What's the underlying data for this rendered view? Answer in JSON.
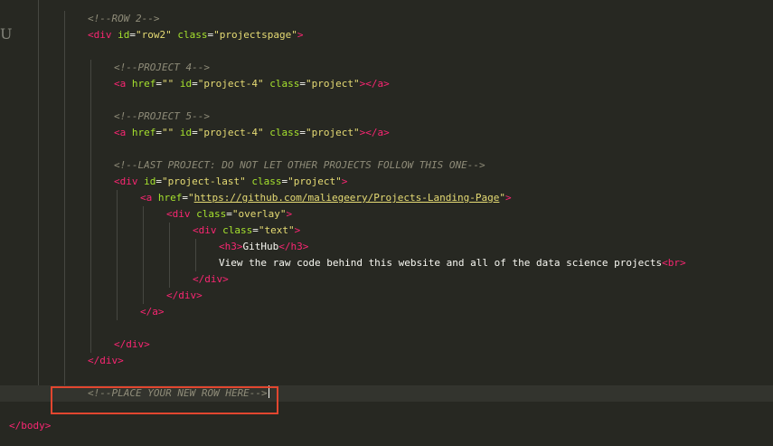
{
  "stray_glyph": "U",
  "lines": [
    {
      "indent": 3,
      "tokens": [
        {
          "t": "comment",
          "v": "<!--ROW 2-->"
        }
      ]
    },
    {
      "indent": 3,
      "tokens": [
        {
          "t": "tag",
          "v": "<div"
        },
        {
          "t": "punct",
          "v": " "
        },
        {
          "t": "attr",
          "v": "id"
        },
        {
          "t": "punct",
          "v": "="
        },
        {
          "t": "string",
          "v": "\"row2\""
        },
        {
          "t": "punct",
          "v": " "
        },
        {
          "t": "attr",
          "v": "class"
        },
        {
          "t": "punct",
          "v": "="
        },
        {
          "t": "string",
          "v": "\"projectspage\""
        },
        {
          "t": "tag",
          "v": ">"
        }
      ]
    },
    {
      "indent": 0,
      "tokens": []
    },
    {
      "indent": 4,
      "tokens": [
        {
          "t": "comment",
          "v": "<!--PROJECT 4-->"
        }
      ]
    },
    {
      "indent": 4,
      "tokens": [
        {
          "t": "tag",
          "v": "<a"
        },
        {
          "t": "punct",
          "v": " "
        },
        {
          "t": "attr",
          "v": "href"
        },
        {
          "t": "punct",
          "v": "="
        },
        {
          "t": "string",
          "v": "\"\""
        },
        {
          "t": "punct",
          "v": " "
        },
        {
          "t": "attr",
          "v": "id"
        },
        {
          "t": "punct",
          "v": "="
        },
        {
          "t": "string",
          "v": "\"project-4\""
        },
        {
          "t": "punct",
          "v": " "
        },
        {
          "t": "attr",
          "v": "class"
        },
        {
          "t": "punct",
          "v": "="
        },
        {
          "t": "string",
          "v": "\"project\""
        },
        {
          "t": "tag",
          "v": "></a>"
        }
      ]
    },
    {
      "indent": 0,
      "tokens": []
    },
    {
      "indent": 4,
      "tokens": [
        {
          "t": "comment",
          "v": "<!--PROJECT 5-->"
        }
      ]
    },
    {
      "indent": 4,
      "tokens": [
        {
          "t": "tag",
          "v": "<a"
        },
        {
          "t": "punct",
          "v": " "
        },
        {
          "t": "attr",
          "v": "href"
        },
        {
          "t": "punct",
          "v": "="
        },
        {
          "t": "string",
          "v": "\"\""
        },
        {
          "t": "punct",
          "v": " "
        },
        {
          "t": "attr",
          "v": "id"
        },
        {
          "t": "punct",
          "v": "="
        },
        {
          "t": "string",
          "v": "\"project-4\""
        },
        {
          "t": "punct",
          "v": " "
        },
        {
          "t": "attr",
          "v": "class"
        },
        {
          "t": "punct",
          "v": "="
        },
        {
          "t": "string",
          "v": "\"project\""
        },
        {
          "t": "tag",
          "v": "></a>"
        }
      ]
    },
    {
      "indent": 0,
      "tokens": []
    },
    {
      "indent": 4,
      "tokens": [
        {
          "t": "comment",
          "v": "<!--LAST PROJECT: DO NOT LET OTHER PROJECTS FOLLOW THIS ONE-->"
        }
      ]
    },
    {
      "indent": 4,
      "tokens": [
        {
          "t": "tag",
          "v": "<div"
        },
        {
          "t": "punct",
          "v": " "
        },
        {
          "t": "attr",
          "v": "id"
        },
        {
          "t": "punct",
          "v": "="
        },
        {
          "t": "string",
          "v": "\"project-last\""
        },
        {
          "t": "punct",
          "v": " "
        },
        {
          "t": "attr",
          "v": "class"
        },
        {
          "t": "punct",
          "v": "="
        },
        {
          "t": "string",
          "v": "\"project\""
        },
        {
          "t": "tag",
          "v": ">"
        }
      ]
    },
    {
      "indent": 5,
      "tokens": [
        {
          "t": "tag",
          "v": "<a"
        },
        {
          "t": "punct",
          "v": " "
        },
        {
          "t": "attr",
          "v": "href"
        },
        {
          "t": "punct",
          "v": "="
        },
        {
          "t": "string",
          "v": "\""
        },
        {
          "t": "link",
          "v": "https://github.com/maliegeery/Projects-Landing-Page"
        },
        {
          "t": "string",
          "v": "\""
        },
        {
          "t": "tag",
          "v": ">"
        }
      ]
    },
    {
      "indent": 6,
      "tokens": [
        {
          "t": "tag",
          "v": "<div"
        },
        {
          "t": "punct",
          "v": " "
        },
        {
          "t": "attr",
          "v": "class"
        },
        {
          "t": "punct",
          "v": "="
        },
        {
          "t": "string",
          "v": "\"overlay\""
        },
        {
          "t": "tag",
          "v": ">"
        }
      ]
    },
    {
      "indent": 7,
      "tokens": [
        {
          "t": "tag",
          "v": "<div"
        },
        {
          "t": "punct",
          "v": " "
        },
        {
          "t": "attr",
          "v": "class"
        },
        {
          "t": "punct",
          "v": "="
        },
        {
          "t": "string",
          "v": "\"text\""
        },
        {
          "t": "tag",
          "v": ">"
        }
      ]
    },
    {
      "indent": 8,
      "tokens": [
        {
          "t": "tag",
          "v": "<h3>"
        },
        {
          "t": "text",
          "v": "GitHub"
        },
        {
          "t": "tag",
          "v": "</h3>"
        }
      ]
    },
    {
      "indent": 8,
      "tokens": [
        {
          "t": "text",
          "v": "View the raw code behind this website and all of the data science projects"
        },
        {
          "t": "tag",
          "v": "<br>"
        }
      ]
    },
    {
      "indent": 7,
      "tokens": [
        {
          "t": "tag",
          "v": "</div>"
        }
      ]
    },
    {
      "indent": 6,
      "tokens": [
        {
          "t": "tag",
          "v": "</div>"
        }
      ]
    },
    {
      "indent": 5,
      "tokens": [
        {
          "t": "tag",
          "v": "</a>"
        }
      ]
    },
    {
      "indent": 0,
      "tokens": []
    },
    {
      "indent": 4,
      "tokens": [
        {
          "t": "tag",
          "v": "</div>"
        }
      ]
    },
    {
      "indent": 3,
      "tokens": [
        {
          "t": "tag",
          "v": "</div>"
        }
      ]
    },
    {
      "indent": 0,
      "tokens": []
    },
    {
      "indent": 3,
      "active": true,
      "cursor": true,
      "tokens": [
        {
          "t": "comment",
          "v": "<!--PLACE YOUR NEW ROW HERE-->"
        }
      ]
    },
    {
      "indent": 0,
      "tokens": []
    },
    {
      "indent": 0,
      "tokens": [
        {
          "t": "tag",
          "v": "</body>"
        }
      ]
    }
  ],
  "colors": {
    "background": "#272822",
    "active_line": "#33342e",
    "comment": "#8f8c79",
    "tag": "#f92672",
    "attribute": "#a6e22e",
    "string": "#e6db74",
    "text": "#f8f8f2",
    "indent_guide": "#464741",
    "highlight_box": "#e2462f"
  }
}
